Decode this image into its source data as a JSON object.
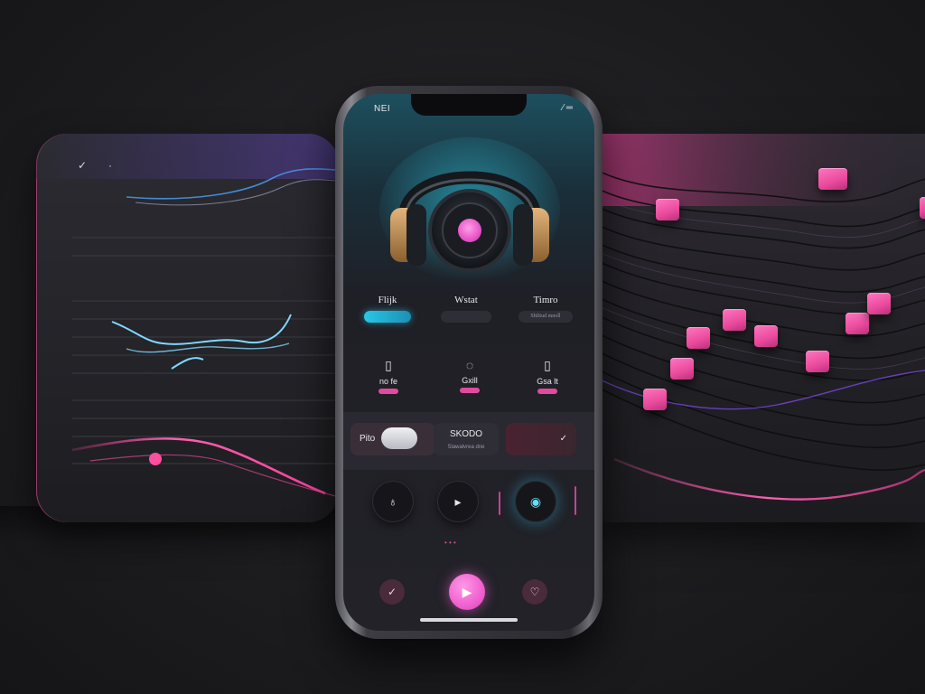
{
  "status": {
    "left": "NEI",
    "right": "⁄ ═"
  },
  "tabs": [
    {
      "label": "Flijk",
      "pill": "",
      "active": true
    },
    {
      "label": "Wstat",
      "pill": "",
      "active": false
    },
    {
      "label": "Timro",
      "pill": "Shfitud mnoll",
      "active": false
    }
  ],
  "options": [
    {
      "label": "no fe",
      "icon": "file-icon"
    },
    {
      "label": "Gxill",
      "icon": "bag-icon"
    },
    {
      "label": "Gsa lt",
      "icon": "file-icon"
    }
  ],
  "modes": [
    {
      "label": "Pito"
    },
    {
      "label": "SKODO",
      "sub": "Slawalvrea dne"
    },
    {
      "label": ""
    }
  ],
  "controls": [
    "mic-icon",
    "skip-icon",
    "equalizer-icon"
  ],
  "bottom": {
    "left_icon": "check-icon",
    "right_icon": "heart-icon"
  },
  "colors": {
    "accent_pink": "#f060d0",
    "accent_cyan": "#2ac7e6"
  }
}
